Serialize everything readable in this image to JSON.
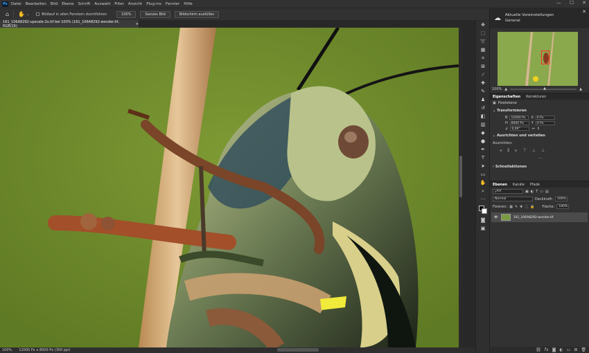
{
  "app": {
    "logo": "Ps"
  },
  "menu": [
    "Datei",
    "Bearbeiten",
    "Bild",
    "Ebene",
    "Schrift",
    "Auswahl",
    "Filter",
    "Ansicht",
    "Plug-ins",
    "Fenster",
    "Hilfe"
  ],
  "window_controls": [
    "—",
    "☐",
    "✕"
  ],
  "options": {
    "scroll_all_label": "Bildlauf in allen Fenstern durchführen",
    "zoom_100": "100%",
    "fit_screen": "Ganzes Bild",
    "fill_screen": "Bildschirm ausfüllen"
  },
  "document": {
    "tab_title": "161_106A8292-upscale-2x.tif bei 100% (161_106A8292-wonder.tif, RGB/16)",
    "close_glyph": "×"
  },
  "status": {
    "zoom": "100%",
    "info": "12000 Px x 8000 Px (300 ppi)"
  },
  "learn": {
    "line1": "Aktuelle Voreinstellungen",
    "line2": "General"
  },
  "navigator": {
    "zoom": "100%"
  },
  "properties": {
    "tabs": [
      "Eigenschaften",
      "Korrekturen"
    ],
    "pixel_layer": "Pixelebene",
    "transform_title": "Transformieren",
    "w_label": "B",
    "w_value": "12000 Px",
    "h_label": "H",
    "h_value": "8000 Px",
    "x_label": "X",
    "x_value": "0 Px",
    "y_label": "Y",
    "y_value": "0 Px",
    "angle_value": "0,00°",
    "align_title": "Ausrichten und verteilen",
    "align_sub": "Ausrichten:",
    "quick_title": "Schnellaktionen"
  },
  "layers": {
    "tabs": [
      "Ebenen",
      "Kanäle",
      "Pfade"
    ],
    "filter_kind": "Art",
    "blend_mode": "Normal",
    "opacity_label": "Deckkraft:",
    "opacity_value": "100%",
    "lock_label": "Fixieren:",
    "fill_label": "Fläche:",
    "fill_value": "100%",
    "layer_name": "161_106A8292-wonder.tif"
  },
  "icons": [
    "home-icon",
    "hand-icon",
    "move-icon",
    "marquee-icon",
    "lasso-icon",
    "crop-icon",
    "eyedropper-icon",
    "brush-icon",
    "stamp-icon",
    "eraser-icon",
    "gradient-icon",
    "pen-icon",
    "type-icon",
    "zoom-icon",
    "eye-icon",
    "trash-icon"
  ]
}
